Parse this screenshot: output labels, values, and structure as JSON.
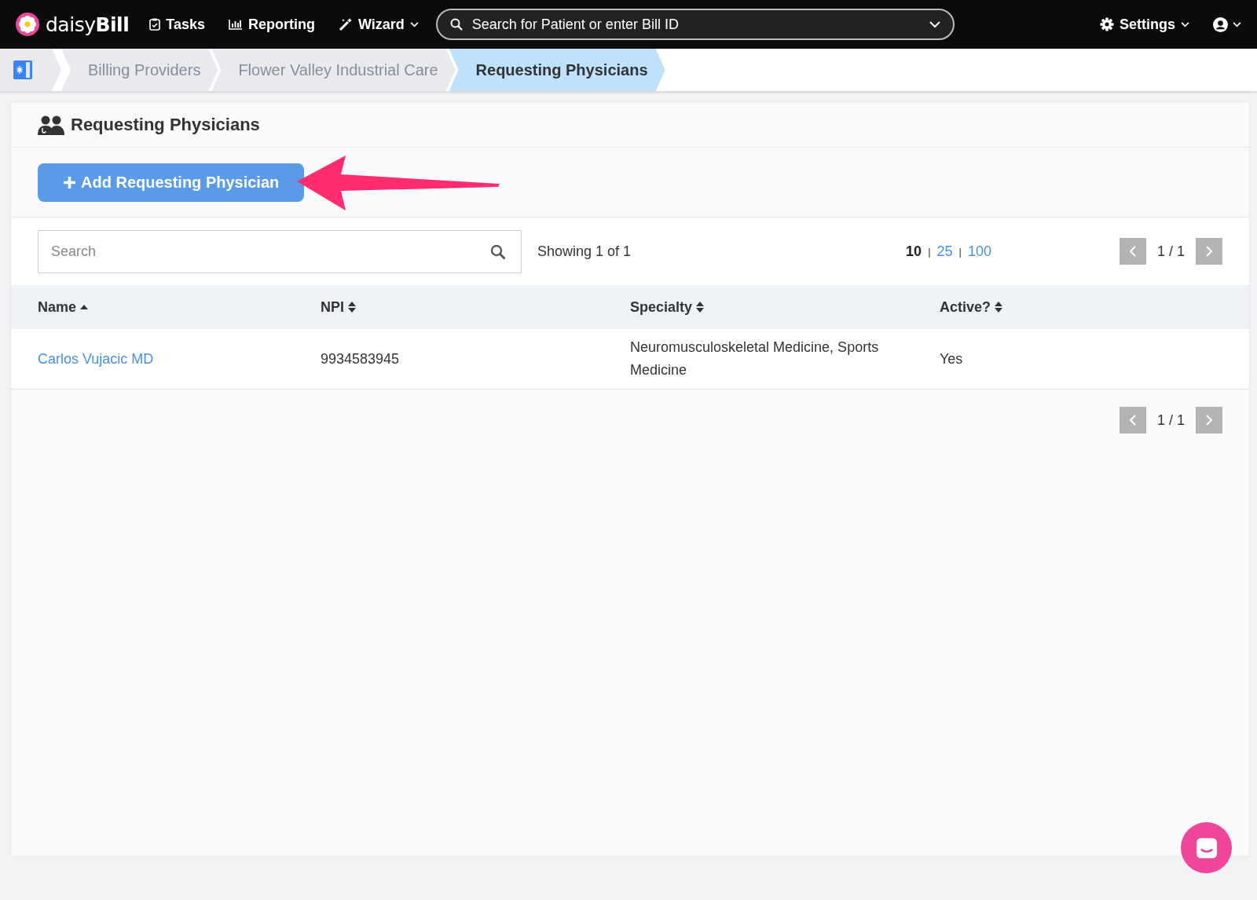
{
  "topbar": {
    "logo": "daisy",
    "logo_bold": "Bill",
    "nav": [
      {
        "label": "Tasks",
        "kind": "tasks",
        "dropdown": false
      },
      {
        "label": "Reporting",
        "kind": "reporting",
        "dropdown": false
      },
      {
        "label": "Wizard",
        "kind": "wizard",
        "dropdown": true
      }
    ],
    "search": {
      "placeholder": "Search for Patient or enter Bill ID"
    },
    "settings": {
      "label": "Settings"
    }
  },
  "breadcrumbs": [
    {
      "label": "Billing Providers",
      "selected": false
    },
    {
      "label": "Flower Valley Industrial Care",
      "selected": false
    },
    {
      "label": "Requesting Physicians",
      "selected": true
    }
  ],
  "panel": {
    "title": "Requesting Physicians",
    "add_button": "Add Requesting Physician"
  },
  "toolbar": {
    "search": {
      "placeholder": "Search"
    },
    "showing": "Showing 1 of 1",
    "page_sizes": [
      {
        "label": "10",
        "selected": true
      },
      {
        "separator": "|",
        "label": "25",
        "selected": false
      },
      {
        "separator": "|",
        "label": "100",
        "selected": false
      }
    ],
    "pager": "1 / 1"
  },
  "table": {
    "columns": [
      {
        "label": "Name",
        "sorted": true
      },
      {
        "label": "NPI",
        "sorted": false
      },
      {
        "label": "Specialty",
        "sorted": false
      },
      {
        "label": "Active?",
        "sorted": false
      }
    ],
    "rows": [
      {
        "name": "Carlos Vujacic MD",
        "npi": "9934583945",
        "specialty": "Neuromusculoskeletal Medicine, Sports Medicine",
        "active": "Yes"
      }
    ]
  },
  "bottom_pager": "1 / 1"
}
